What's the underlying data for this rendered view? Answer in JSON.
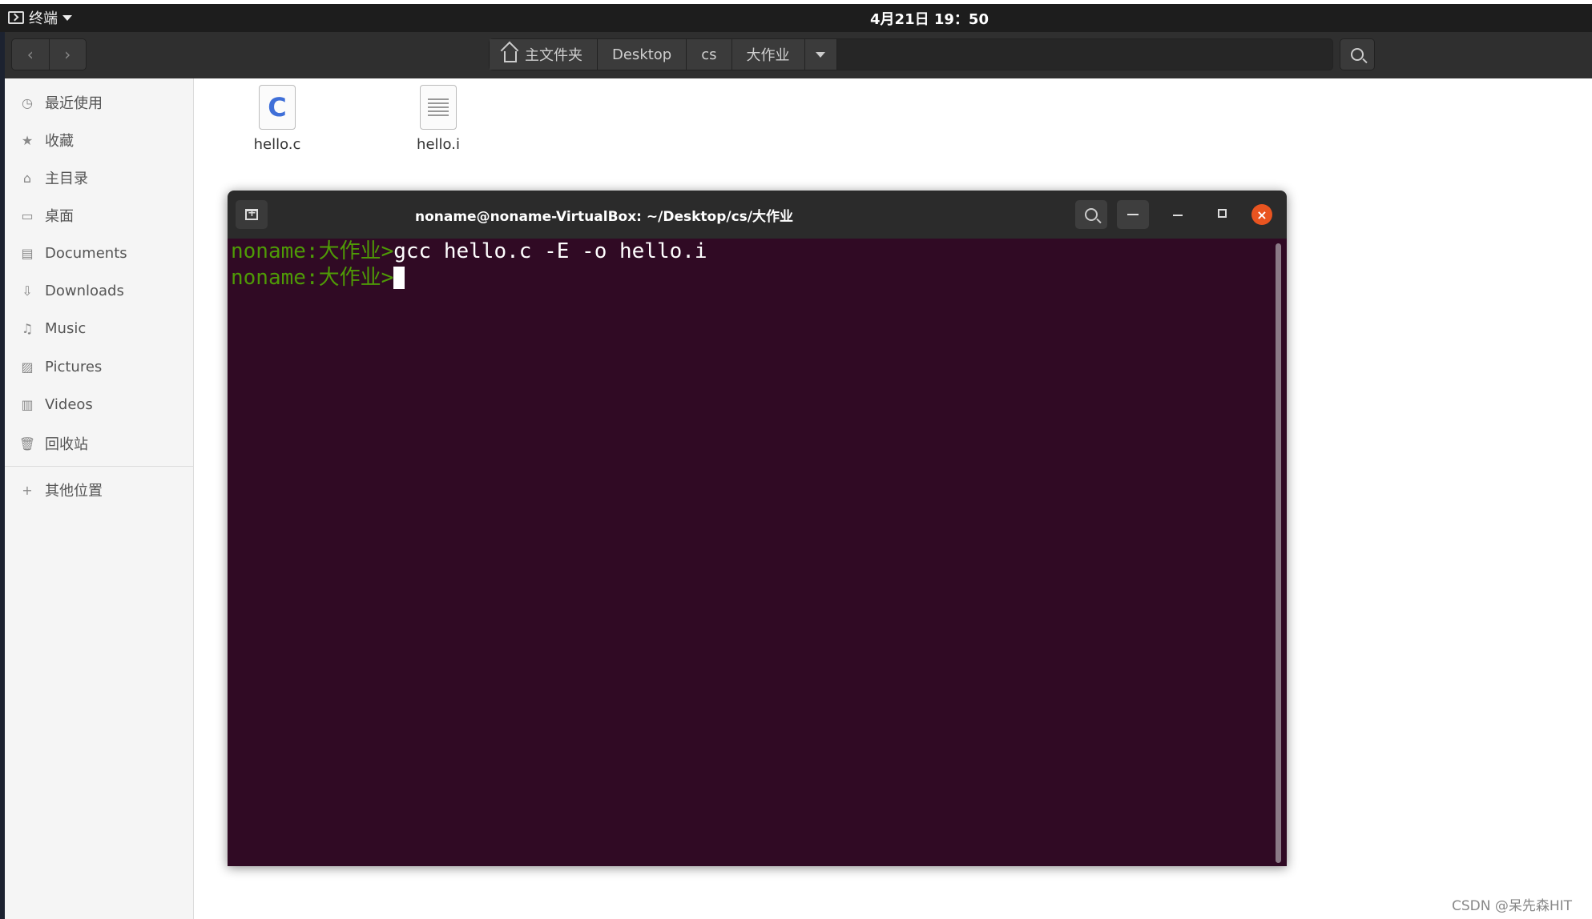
{
  "topbar": {
    "app_name": "终端",
    "clock": "4月21日 19：50"
  },
  "file_manager": {
    "breadcrumbs": [
      "主文件夹",
      "Desktop",
      "cs",
      "大作业"
    ],
    "sidebar": {
      "items": [
        {
          "label": "最近使用",
          "icon": "clock-icon"
        },
        {
          "label": "收藏",
          "icon": "star-icon"
        },
        {
          "label": "主目录",
          "icon": "home-icon"
        },
        {
          "label": "桌面",
          "icon": "desktop-icon"
        },
        {
          "label": "Documents",
          "icon": "document-icon"
        },
        {
          "label": "Downloads",
          "icon": "download-icon"
        },
        {
          "label": "Music",
          "icon": "music-icon"
        },
        {
          "label": "Pictures",
          "icon": "picture-icon"
        },
        {
          "label": "Videos",
          "icon": "video-icon"
        },
        {
          "label": "回收站",
          "icon": "trash-icon"
        }
      ],
      "other_locations": "其他位置"
    },
    "files": [
      {
        "name": "hello.c",
        "icon": "c-source-file-icon"
      },
      {
        "name": "hello.i",
        "icon": "text-file-icon"
      }
    ]
  },
  "terminal": {
    "title": "noname@noname-VirtualBox: ~/Desktop/cs/大作业",
    "lines": [
      {
        "prompt": "noname:大作业>",
        "command": "gcc hello.c -E -o hello.i"
      },
      {
        "prompt": "noname:大作业>",
        "command": ""
      }
    ],
    "colors": {
      "background": "#300a24",
      "prompt": "#4e9a06",
      "close": "#e95420"
    }
  },
  "watermark": "CSDN @呆先森HIT"
}
